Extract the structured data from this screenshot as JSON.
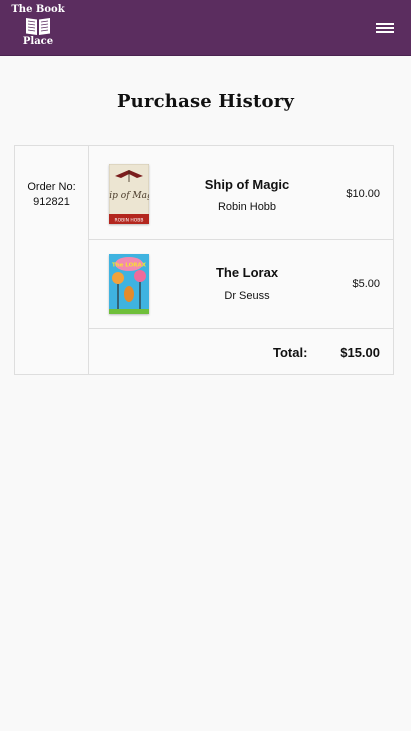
{
  "header": {
    "logo_line1": "The Book",
    "logo_line2": "Place",
    "logo_icon": "open-book-icon",
    "menu_icon": "hamburger-menu-icon",
    "background_color": "#5b2d5f"
  },
  "page": {
    "title": "Purchase History"
  },
  "order": {
    "label": "Order No:",
    "number": "912821",
    "items": [
      {
        "title": "Ship of Magic",
        "author": "Robin Hobb",
        "price": "$10.00",
        "cover_top_text": "Ship of Magic",
        "cover_bottom_text": "ROBIN HOBB"
      },
      {
        "title": "The Lorax",
        "author": "Dr Seuss",
        "price": "$5.00",
        "cover_top_text": "The LORAX"
      }
    ],
    "total_label": "Total:",
    "total_value": "$15.00"
  }
}
